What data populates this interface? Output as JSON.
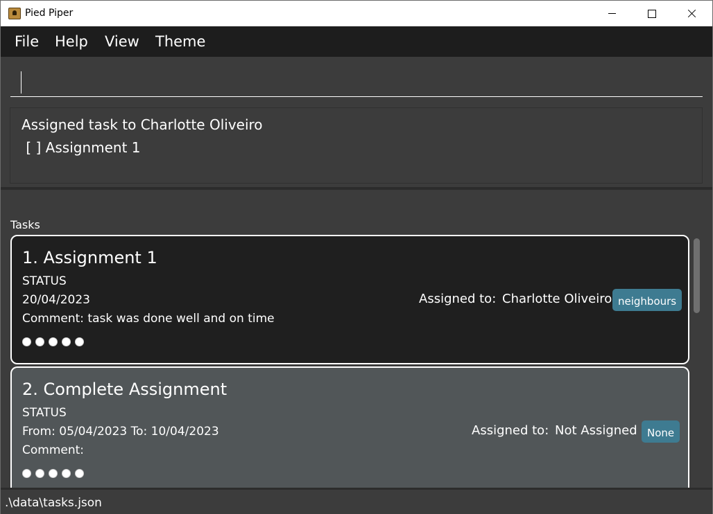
{
  "window": {
    "title": "Pied Piper"
  },
  "menu": {
    "items": [
      "File",
      "Help",
      "View",
      "Theme"
    ]
  },
  "command_box": {
    "value": ""
  },
  "result": {
    "line1": "Assigned task to Charlotte Oliveiro",
    "line2": " [ ] Assignment 1"
  },
  "tasks": {
    "label": "Tasks",
    "cards": [
      {
        "title": "1. Assignment 1",
        "status": "STATUS",
        "date": "20/04/2023",
        "comment": "Comment: task was done well and on time",
        "assigned_label": "Assigned to:",
        "assignee": "Charlotte Oliveiro",
        "tag": "neighbours",
        "rating_dots": 5
      },
      {
        "title": "2. Complete Assignment",
        "status": "STATUS",
        "date": "From: 05/04/2023 To: 10/04/2023",
        "comment": "Comment:",
        "assigned_label": "Assigned to:",
        "assignee": "Not Assigned",
        "tag": "None",
        "rating_dots": 5
      }
    ]
  },
  "status_bar": {
    "path": ".\\data\\tasks.json"
  },
  "colors": {
    "menu_bg": "#1d1d1d",
    "panel_bg": "#3c3c3c",
    "card_dark": "#1f1f1f",
    "card_selected": "#515658",
    "tag_bg": "#3e7b91"
  }
}
